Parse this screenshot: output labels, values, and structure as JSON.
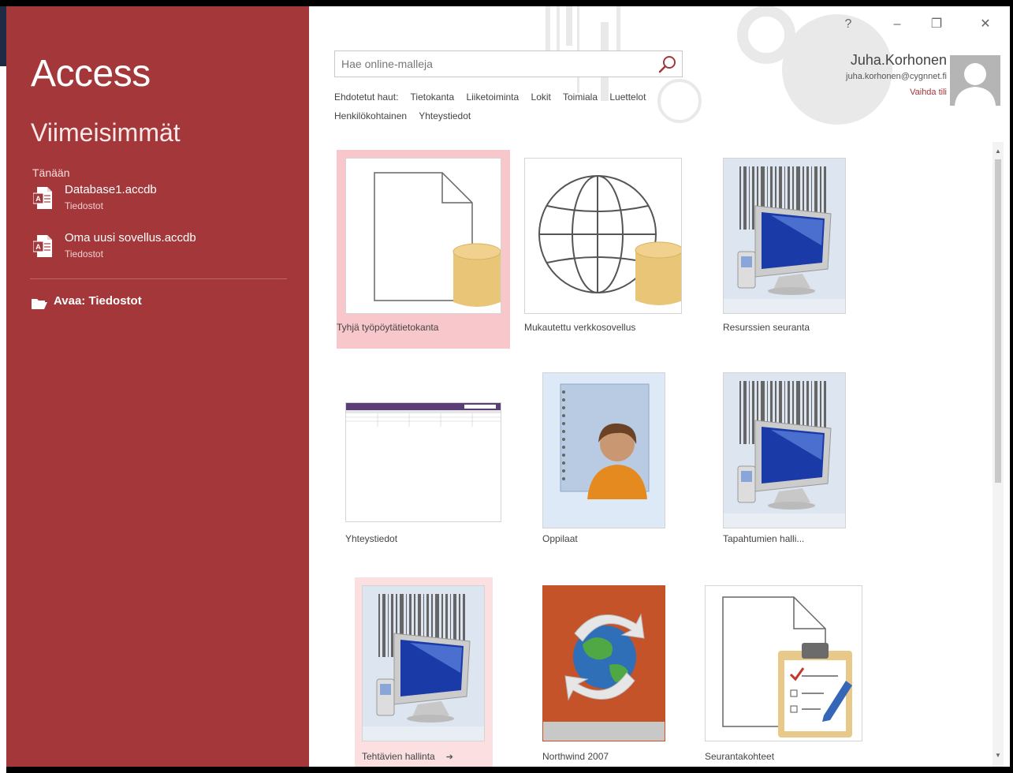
{
  "app": {
    "title": "Access",
    "accent_color": "#a4373a"
  },
  "window_controls": {
    "help": "?",
    "minimize": "–",
    "restore": "❐",
    "close": "✕"
  },
  "sidebar": {
    "section_title": "Viimeisimmät",
    "group_label": "Tänään",
    "recent": [
      {
        "name": "Database1.accdb",
        "location": "Tiedostot"
      },
      {
        "name": "Oma uusi sovellus.accdb",
        "location": "Tiedostot"
      }
    ],
    "open_label": "Avaa: Tiedostot"
  },
  "search": {
    "placeholder": "Hae online-malleja",
    "suggested_label": "Ehdotetut haut:",
    "suggestions": [
      "Tietokanta",
      "Liiketoiminta",
      "Lokit",
      "Toimiala",
      "Luettelot",
      "Henkilökohtainen",
      "Yhteystiedot"
    ]
  },
  "account": {
    "name": "Juha.Korhonen",
    "email": "juha.korhonen@cygnnet.fi",
    "switch_label": "Vaihda tili"
  },
  "templates": [
    {
      "label": "Tyhjä työpöytätietokanta",
      "icon": "blank-database-icon",
      "state": "selected"
    },
    {
      "label": "Mukautettu verkkosovellus",
      "icon": "globe-database-icon",
      "state": "normal"
    },
    {
      "label": "Resurssien seuranta",
      "icon": "computer-barcode-icon",
      "state": "normal"
    },
    {
      "label": "Yhteystiedot",
      "icon": "contacts-form-icon",
      "state": "normal"
    },
    {
      "label": "Oppilaat",
      "icon": "student-notebook-icon",
      "state": "normal"
    },
    {
      "label": "Tapahtumien halli...",
      "icon": "computer-barcode-icon",
      "state": "normal"
    },
    {
      "label": "Tehtävien hallinta",
      "icon": "computer-barcode-icon",
      "state": "hover"
    },
    {
      "label": "Northwind 2007",
      "icon": "northwind-globe-icon",
      "state": "normal"
    },
    {
      "label": "Seurantakohteet",
      "icon": "clipboard-checklist-icon",
      "state": "normal"
    }
  ]
}
